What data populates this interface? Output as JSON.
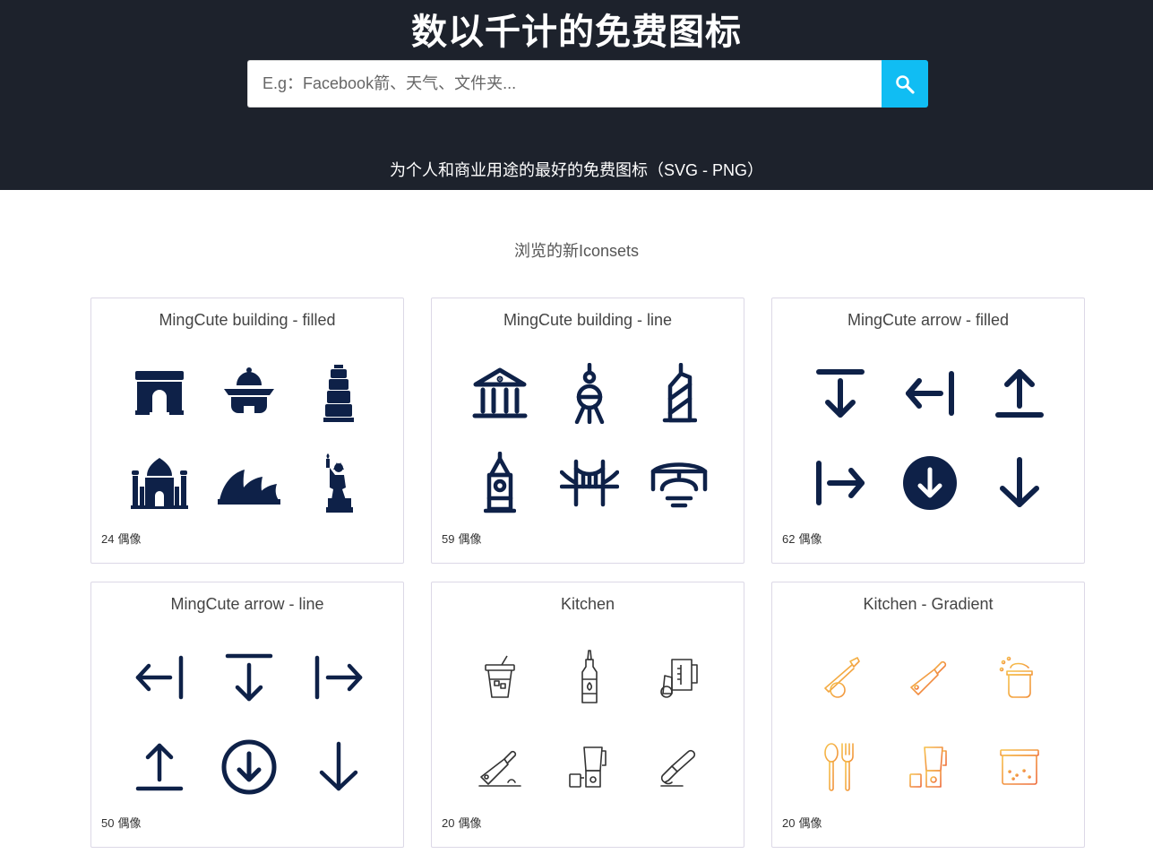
{
  "hero": {
    "title": "数以千计的免费图标",
    "search_placeholder": "E.g：Facebook箭、天气、文件夹...",
    "subtitle": "为个人和商业用途的最好的免费图标（SVG - PNG）",
    "search_icon": "search-icon"
  },
  "section": {
    "title": "浏览的新Iconsets"
  },
  "colors": {
    "hero_bg": "#1d222c",
    "search_button": "#10bdf3",
    "icon_dark": "#0e2148",
    "gradient_start": "#f6b53e",
    "gradient_end": "#f1913a"
  },
  "cards": [
    {
      "title": "MingCute building - filled",
      "count": "24",
      "unit": "偶像",
      "icons": [
        "arc-de-triomphe-icon",
        "pavilion-icon",
        "pagoda-icon",
        "taj-mahal-icon",
        "opera-house-icon",
        "statue-of-liberty-icon"
      ]
    },
    {
      "title": "MingCute building - line",
      "count": "59",
      "unit": "偶像",
      "icons": [
        "bank-icon",
        "tv-tower-icon",
        "skyscraper-icon",
        "big-ben-icon",
        "bridge-icon",
        "arch-bridge-icon"
      ]
    },
    {
      "title": "MingCute arrow - filled",
      "count": "62",
      "unit": "偶像",
      "icons": [
        "arrow-down-to-line-icon",
        "arrow-left-to-line-icon",
        "arrow-up-from-line-icon",
        "arrow-right-from-line-icon",
        "arrow-down-circle-icon",
        "arrow-down-icon"
      ]
    },
    {
      "title": "MingCute arrow - line",
      "count": "50",
      "unit": "偶像",
      "icons": [
        "arrow-left-to-line-icon",
        "arrow-down-to-line-icon",
        "arrow-right-from-line-icon",
        "arrow-up-from-line-icon",
        "arrow-down-circle-icon",
        "arrow-down-icon"
      ]
    },
    {
      "title": "Kitchen",
      "count": "20",
      "unit": "偶像",
      "icons": [
        "drink-cup-icon",
        "sauce-bottle-icon",
        "measuring-jug-icon",
        "cleaver-icon",
        "blender-icon",
        "spatula-icon"
      ]
    },
    {
      "title": "Kitchen - Gradient",
      "count": "20",
      "unit": "偶像",
      "icons": [
        "knife-onion-icon",
        "cleaver-icon",
        "cooking-pot-icon",
        "spoon-fork-icon",
        "blender-icon",
        "food-container-icon"
      ]
    }
  ]
}
